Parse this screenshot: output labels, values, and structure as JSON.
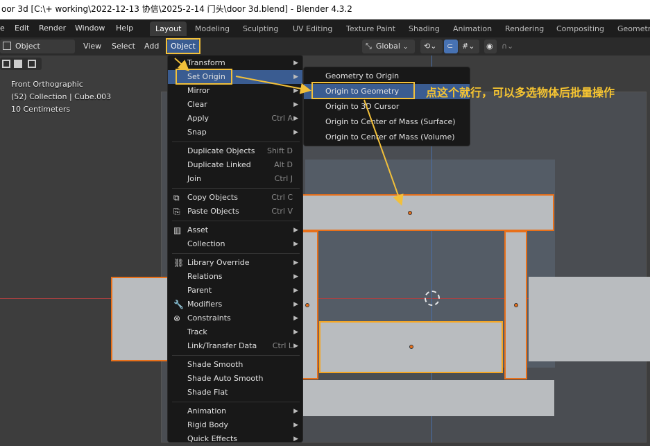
{
  "window": {
    "title": "oor 3d [C:\\+ working\\2022-12-13 协信\\2025-2-14 门头\\door 3d.blend] - Blender 4.3.2"
  },
  "menubar": {
    "items": [
      "e",
      "Edit",
      "Render",
      "Window",
      "Help"
    ],
    "workspaces": [
      "Layout",
      "Modeling",
      "Sculpting",
      "UV Editing",
      "Texture Paint",
      "Shading",
      "Animation",
      "Rendering",
      "Compositing",
      "Geometr"
    ],
    "active_workspace": "Layout"
  },
  "header": {
    "mode": "Object Mode",
    "view": "View",
    "select": "Select",
    "add": "Add",
    "object": "Object",
    "transform_orientation": "Global"
  },
  "viewport": {
    "view_name": "Front Orthographic",
    "collection": "(52) Collection | Cube.003",
    "scale": "10 Centimeters"
  },
  "object_menu": {
    "items": [
      {
        "label": "Transform",
        "shortcut": "",
        "submenu": true,
        "icon": ""
      },
      {
        "label": "Set Origin",
        "shortcut": "",
        "submenu": true,
        "icon": ""
      },
      {
        "label": "Mirror",
        "shortcut": "",
        "submenu": true,
        "icon": ""
      },
      {
        "label": "Clear",
        "shortcut": "",
        "submenu": true,
        "icon": ""
      },
      {
        "label": "Apply",
        "shortcut": "Ctrl A",
        "submenu": true,
        "icon": ""
      },
      {
        "label": "Snap",
        "shortcut": "",
        "submenu": true,
        "icon": ""
      },
      {
        "label": "Duplicate Objects",
        "shortcut": "Shift D",
        "submenu": false,
        "icon": ""
      },
      {
        "label": "Duplicate Linked",
        "shortcut": "Alt D",
        "submenu": false,
        "icon": ""
      },
      {
        "label": "Join",
        "shortcut": "Ctrl J",
        "submenu": false,
        "icon": ""
      },
      {
        "label": "Copy Objects",
        "shortcut": "Ctrl C",
        "submenu": false,
        "icon": "copy-icon"
      },
      {
        "label": "Paste Objects",
        "shortcut": "Ctrl V",
        "submenu": false,
        "icon": "paste-icon"
      },
      {
        "label": "Asset",
        "shortcut": "",
        "submenu": true,
        "icon": "asset-icon"
      },
      {
        "label": "Collection",
        "shortcut": "",
        "submenu": true,
        "icon": ""
      },
      {
        "label": "Library Override",
        "shortcut": "",
        "submenu": true,
        "icon": "library-override-icon"
      },
      {
        "label": "Relations",
        "shortcut": "",
        "submenu": true,
        "icon": ""
      },
      {
        "label": "Parent",
        "shortcut": "",
        "submenu": true,
        "icon": ""
      },
      {
        "label": "Modifiers",
        "shortcut": "",
        "submenu": true,
        "icon": "wrench-icon"
      },
      {
        "label": "Constraints",
        "shortcut": "",
        "submenu": true,
        "icon": "constraint-icon"
      },
      {
        "label": "Track",
        "shortcut": "",
        "submenu": true,
        "icon": ""
      },
      {
        "label": "Link/Transfer Data",
        "shortcut": "Ctrl L",
        "submenu": true,
        "icon": ""
      },
      {
        "label": "Shade Smooth",
        "shortcut": "",
        "submenu": false,
        "icon": ""
      },
      {
        "label": "Shade Auto Smooth",
        "shortcut": "",
        "submenu": false,
        "icon": ""
      },
      {
        "label": "Shade Flat",
        "shortcut": "",
        "submenu": false,
        "icon": ""
      },
      {
        "label": "Animation",
        "shortcut": "",
        "submenu": true,
        "icon": ""
      },
      {
        "label": "Rigid Body",
        "shortcut": "",
        "submenu": true,
        "icon": ""
      },
      {
        "label": "Quick Effects",
        "shortcut": "",
        "submenu": true,
        "icon": ""
      }
    ]
  },
  "set_origin_menu": {
    "items": [
      "Geometry to Origin",
      "Origin to Geometry",
      "Origin to 3D Cursor",
      "Origin to Center of Mass (Surface)",
      "Origin to Center of Mass (Volume)"
    ]
  },
  "annotation": {
    "text": "点这个就行，可以多选物体后批量操作"
  },
  "colors": {
    "accent": "#f2c03a",
    "selection": "#e8701a",
    "highlight": "#3a5c91"
  }
}
